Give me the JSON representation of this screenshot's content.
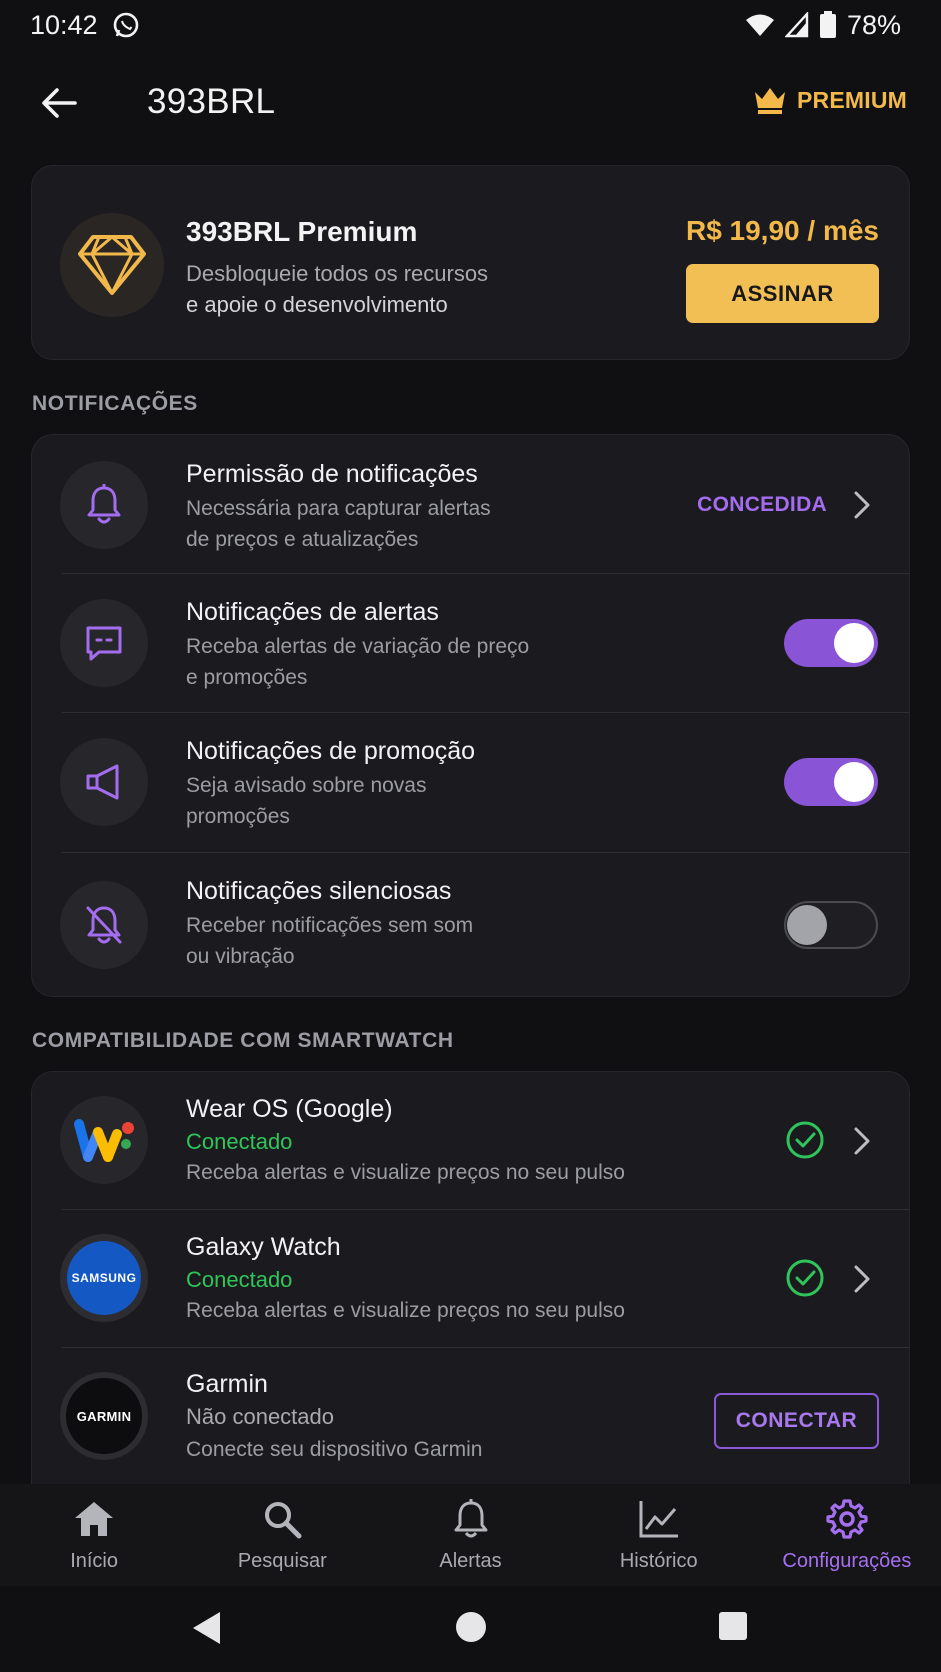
{
  "status_bar": {
    "time": "10:42",
    "battery": "78%"
  },
  "app_bar": {
    "title": "393BRL",
    "premium_label": "PREMIUM"
  },
  "premium_card": {
    "title": "393BRL Premium",
    "desc_line1": "Desbloqueie todos os recursos",
    "desc_line2": "e apoie o desenvolvimento",
    "price": "R$ 19,90 / mês",
    "cta": "ASSINAR"
  },
  "notifications": {
    "header": "NOTIFICAÇÕES",
    "items": [
      {
        "title": "Permissão de notificações",
        "sub1": "Necessária para capturar alertas",
        "sub2": "de preços e atualizações",
        "status": "CONCEDIDA"
      },
      {
        "title": "Notificações de alertas",
        "sub1": "Receba alertas de variação de preço",
        "sub2": "e promoções",
        "enabled": true
      },
      {
        "title": "Notificações de promoção",
        "sub1": "Seja avisado sobre novas",
        "sub2": "promoções",
        "enabled": true
      },
      {
        "title": "Notificações silenciosas",
        "sub1": "Receber notificações sem som",
        "sub2": "ou vibração",
        "enabled": false
      }
    ]
  },
  "smartwatch": {
    "header": "COMPATIBILIDADE COM SMARTWATCH",
    "items": [
      {
        "title": "Wear OS (Google)",
        "status": "Conectado",
        "desc": "Receba alertas e visualize preços no seu pulso"
      },
      {
        "title": "Galaxy Watch",
        "status": "Conectado",
        "desc": "Receba alertas e visualize preços no seu pulso",
        "logo_text": "SAMSUNG"
      },
      {
        "title": "Garmin",
        "status": "Não conectado",
        "desc": "Conecte seu dispositivo Garmin",
        "logo_text": "GARMIN",
        "cta": "CONECTAR"
      }
    ]
  },
  "bottom_nav": [
    {
      "label": "Início",
      "icon": "home-icon"
    },
    {
      "label": "Pesquisar",
      "icon": "search-icon"
    },
    {
      "label": "Alertas",
      "icon": "bell-icon"
    },
    {
      "label": "Histórico",
      "icon": "chart-icon"
    },
    {
      "label": "Configurações",
      "icon": "gear-icon",
      "active": true
    }
  ],
  "colors": {
    "accent": "#8a54d6",
    "gold": "#f2b94a",
    "success": "#2fc55a",
    "background": "#101012",
    "card": "#1b1b1f"
  }
}
